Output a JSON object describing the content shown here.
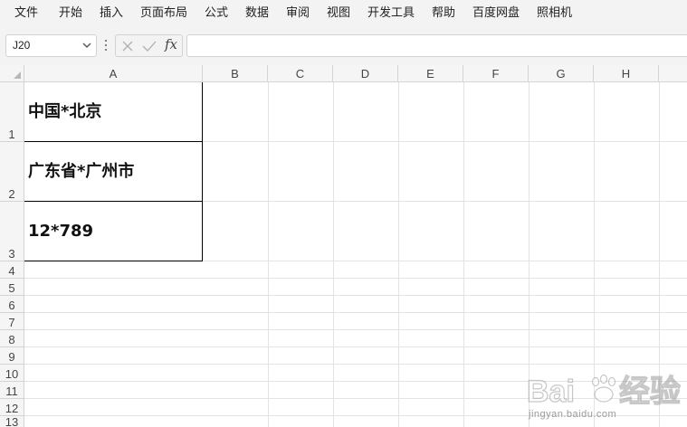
{
  "menu": {
    "items": [
      "文件",
      "开始",
      "插入",
      "页面布局",
      "公式",
      "数据",
      "审阅",
      "视图",
      "开发工具",
      "帮助",
      "百度网盘",
      "照相机"
    ]
  },
  "formula_bar": {
    "name_box": "J20",
    "fx_label": "fx",
    "formula": ""
  },
  "sheet": {
    "columns": [
      "A",
      "B",
      "C",
      "D",
      "E",
      "F",
      "G",
      "H"
    ],
    "rows": [
      "1",
      "2",
      "3",
      "4",
      "5",
      "6",
      "7",
      "8",
      "9",
      "10",
      "11",
      "12",
      "13"
    ],
    "cells": {
      "A1": "中国*北京",
      "A2": "广东省*广州市",
      "A3": "12*789"
    }
  },
  "watermark": {
    "brand": "Baidu经验",
    "domain": "jingyan.baidu.com"
  },
  "colors": {
    "ribbon_bg": "#f3f3f3",
    "header_bg": "#f5f5f5",
    "gridline": "#e3e3e3",
    "border": "#000000"
  }
}
